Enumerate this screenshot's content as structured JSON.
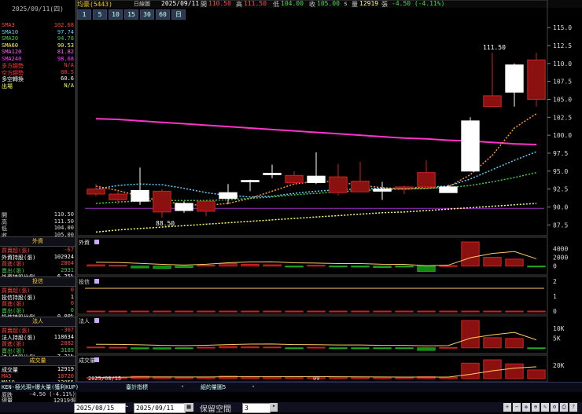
{
  "header": {
    "stock": "均豪(5443)",
    "mode": "日線圖",
    "date": "2025/09/11",
    "open_label": "開",
    "open": "110.50",
    "high_label": "高",
    "high": "111.50",
    "low_label": "低",
    "low": "104.00",
    "close_label": "收",
    "close": "105.00",
    "volume_label": "量",
    "volume": "12919",
    "change_label": "張",
    "change": "-4.50 (-4.11%)",
    "period_unit": "s"
  },
  "left_panel": {
    "date": "2025/09/11(四)",
    "indicators": [
      {
        "name": "SMA3",
        "value": "102.68",
        "color": "#ff4444"
      },
      {
        "name": "SMA10",
        "value": "97.74",
        "color": "#66ccff"
      },
      {
        "name": "SMA20",
        "value": "94.78",
        "color": "#44cc44"
      },
      {
        "name": "SMA60",
        "value": "90.53",
        "color": "#ffff66"
      },
      {
        "name": "SMA120",
        "value": "81.82",
        "color": "#ff66ff"
      },
      {
        "name": "SMA240",
        "value": "98.68",
        "color": "#ff44ff"
      },
      {
        "name": "多方趨勢",
        "value": "N/A",
        "color": "#ff3333"
      },
      {
        "name": "空方趨勢",
        "value": "88.5",
        "color": "#ff3333"
      },
      {
        "name": "多空轉換",
        "value": "60.6",
        "color": "#ffffff"
      },
      {
        "name": "出場",
        "value": "N/A",
        "color": "#ffff66"
      }
    ],
    "ohlc": [
      {
        "name": "開",
        "value": "110.50"
      },
      {
        "name": "高",
        "value": "111.50"
      },
      {
        "name": "低",
        "value": "104.00"
      },
      {
        "name": "收",
        "value": "105.00"
      }
    ],
    "foreign": {
      "title": "外資",
      "rows": [
        {
          "name": "買賣超(張)",
          "value": "-67",
          "color": "#ff4444"
        },
        {
          "name": "外資持股(張)",
          "value": "102924",
          "color": "#ffffff"
        },
        {
          "name": "買進(張)",
          "value": "2864",
          "color": "#ff4444"
        },
        {
          "name": "賣出(張)",
          "value": "2931",
          "color": "#44cc44"
        },
        {
          "name": "外資持股比例",
          "value": "6.25%",
          "color": "#ffffff"
        }
      ]
    },
    "trust": {
      "title": "投信",
      "rows": [
        {
          "name": "買賣超(張)",
          "value": "0",
          "color": "#ff4444"
        },
        {
          "name": "投信持股(張)",
          "value": "1",
          "color": "#ffffff"
        },
        {
          "name": "買進(張)",
          "value": "0",
          "color": "#ff4444"
        },
        {
          "name": "賣出(張)",
          "value": "0",
          "color": "#44cc44"
        },
        {
          "name": "投信持股比例",
          "value": "0.00%",
          "color": "#ffffff"
        }
      ]
    },
    "legal": {
      "title": "法人",
      "rows": [
        {
          "name": "買賣超(張)",
          "value": "-307",
          "color": "#ff4444"
        },
        {
          "name": "法人持股(張)",
          "value": "118634",
          "color": "#ffffff"
        },
        {
          "name": "買進(張)",
          "value": "2882",
          "color": "#ff4444"
        },
        {
          "name": "賣出(張)",
          "value": "3189",
          "color": "#44cc44"
        },
        {
          "name": "法人持股比例",
          "value": "7.21%",
          "color": "#ffffff"
        }
      ]
    },
    "volume": {
      "title": "成交量",
      "rows": [
        {
          "name": "成交量",
          "value": "12919",
          "color": "#ffffff"
        },
        {
          "name": "MA5",
          "value": "18720",
          "color": "#ff4444"
        },
        {
          "name": "MA10",
          "value": "12055",
          "color": "#ffff66"
        }
      ]
    }
  },
  "periods": [
    "1",
    "5",
    "10",
    "15",
    "30",
    "60",
    "日"
  ],
  "price_axis": [
    "115.0",
    "112.5",
    "110.0",
    "107.5",
    "105.0",
    "102.5",
    "100.0",
    "97.5",
    "95.0",
    "92.5",
    "90.0",
    "87.5"
  ],
  "annotations": {
    "high_mark": "111.50",
    "low_mark": "88.50"
  },
  "chart_data": {
    "type": "candlestick",
    "x_labels": [
      "2025/08/15",
      "09"
    ],
    "ylim": [
      86,
      116
    ],
    "candles": [
      {
        "o": 92.5,
        "h": 93.2,
        "l": 91.5,
        "c": 91.8
      },
      {
        "o": 91.8,
        "h": 92.3,
        "l": 90.4,
        "c": 91.0
      },
      {
        "o": 90.8,
        "h": 95.5,
        "l": 90.3,
        "c": 92.3
      },
      {
        "o": 92.2,
        "h": 92.5,
        "l": 88.5,
        "c": 89.3
      },
      {
        "o": 89.5,
        "h": 90.8,
        "l": 89.2,
        "c": 90.5
      },
      {
        "o": 90.8,
        "h": 90.9,
        "l": 88.7,
        "c": 89.4
      },
      {
        "o": 91.2,
        "h": 93.2,
        "l": 90.4,
        "c": 92.0
      },
      {
        "o": 93.5,
        "h": 93.8,
        "l": 92.2,
        "c": 93.7
      },
      {
        "o": 94.5,
        "h": 95.9,
        "l": 94.0,
        "c": 94.7
      },
      {
        "o": 94.4,
        "h": 95.0,
        "l": 93.1,
        "c": 93.4
      },
      {
        "o": 93.4,
        "h": 97.6,
        "l": 93.2,
        "c": 94.3
      },
      {
        "o": 94.2,
        "h": 96.0,
        "l": 91.6,
        "c": 92.0
      },
      {
        "o": 93.6,
        "h": 96.3,
        "l": 92.2,
        "c": 92.1
      },
      {
        "o": 92.2,
        "h": 93.5,
        "l": 91.0,
        "c": 92.5
      },
      {
        "o": 92.8,
        "h": 93.0,
        "l": 91.8,
        "c": 92.7
      },
      {
        "o": 94.8,
        "h": 96.5,
        "l": 93.1,
        "c": 92.8
      },
      {
        "o": 92.0,
        "h": 93.1,
        "l": 92.3,
        "c": 92.8
      },
      {
        "o": 95.0,
        "h": 102.5,
        "l": 95.0,
        "c": 102.0
      },
      {
        "o": 105.5,
        "h": 111.5,
        "l": 104.0,
        "c": 104.0
      },
      {
        "o": 106.0,
        "h": 110.0,
        "l": 104.0,
        "c": 109.8
      },
      {
        "o": 110.5,
        "h": 111.5,
        "l": 104.0,
        "c": 105.0
      }
    ],
    "sma3": [
      92.9,
      92.3,
      91.5,
      90.8,
      90.4,
      90.2,
      90.5,
      91.2,
      92.2,
      93.2,
      93.6,
      93.5,
      93.0,
      92.7,
      92.5,
      92.6,
      92.8,
      94.5,
      97.2,
      101.0,
      103.0
    ],
    "sma10": [
      92.5,
      93.0,
      93.2,
      93.1,
      92.6,
      92.0,
      91.6,
      91.4,
      91.5,
      91.9,
      92.2,
      92.4,
      92.5,
      92.6,
      92.6,
      92.8,
      92.9,
      93.9,
      95.2,
      96.5,
      97.7
    ],
    "sma20": [
      90.5,
      90.7,
      90.8,
      90.9,
      90.9,
      90.9,
      91.0,
      91.2,
      91.4,
      91.7,
      91.9,
      92.1,
      92.3,
      92.4,
      92.5,
      92.6,
      92.7,
      93.0,
      93.5,
      94.1,
      94.8
    ],
    "sma60": [
      86.5,
      86.8,
      87.0,
      87.2,
      87.4,
      87.6,
      87.8,
      88.0,
      88.2,
      88.4,
      88.6,
      88.8,
      89.0,
      89.2,
      89.3,
      89.5,
      89.7,
      89.9,
      90.1,
      90.3,
      90.5
    ],
    "sma240": [
      102.3,
      102.2,
      102.0,
      101.8,
      101.6,
      101.4,
      101.2,
      101.0,
      100.8,
      100.6,
      100.4,
      100.2,
      100.0,
      99.8,
      99.6,
      99.5,
      99.3,
      99.2,
      99.0,
      98.8,
      98.7
    ],
    "flat_line": 89.8,
    "foreign_net": [
      300,
      200,
      -400,
      -500,
      -300,
      200,
      600,
      400,
      300,
      -200,
      200,
      -100,
      -200,
      -300,
      -200,
      -1200,
      100,
      5500,
      2000,
      1600,
      -67
    ],
    "trust_net": [
      0,
      0,
      0,
      0,
      0,
      0,
      0,
      0,
      0,
      0,
      0,
      0,
      0,
      0,
      0,
      0,
      0,
      0,
      0,
      0,
      0
    ],
    "legal_net": [
      400,
      300,
      -500,
      -600,
      -400,
      300,
      800,
      500,
      400,
      -300,
      300,
      -200,
      -300,
      -400,
      -200,
      -1300,
      200,
      14000,
      5200,
      4800,
      -307
    ],
    "volume": [
      1800,
      2200,
      3500,
      2600,
      2000,
      2100,
      3900,
      3200,
      3000,
      2500,
      2600,
      2400,
      2300,
      2300,
      2200,
      2800,
      2100,
      23000,
      28000,
      22000,
      12919
    ]
  },
  "panels": {
    "foreign_label": "外資",
    "foreign_axis": [
      "4000",
      "2000",
      "0"
    ],
    "trust_label": "投信",
    "trust_axis": [
      "2",
      "1",
      "0"
    ],
    "legal_label": "法人",
    "legal_axis": [
      "10K",
      "5K"
    ],
    "volume_label": "成交量",
    "volume_axis": [
      "20K"
    ]
  },
  "bottom_bar": {
    "item1": "KEN-極光現+爆大量(獲利KUP)",
    "item2": "臺計指標",
    "item3": "組的量圖5"
  },
  "footer": {
    "left1": "原跌",
    "left1_v": "-4.50 (-4.11%)",
    "left2": "總量",
    "left2_v": "12919張",
    "from_date": "2025/08/15",
    "tilde": "~",
    "to_date": "2025/09/11",
    "retain_label": "保留空間",
    "retain_value": "3"
  }
}
